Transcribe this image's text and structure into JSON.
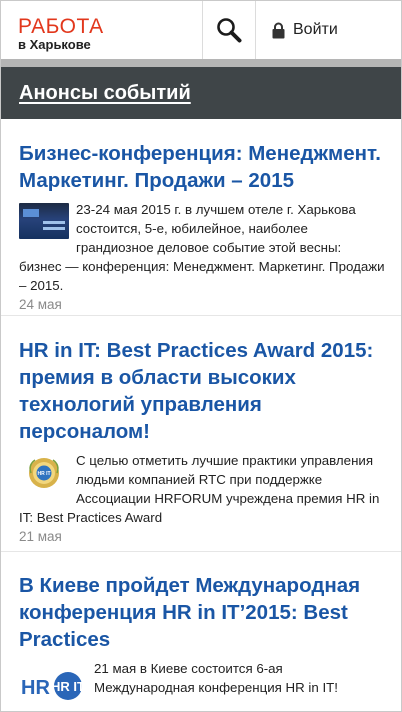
{
  "header": {
    "logo_top": "РАБОТА",
    "logo_bottom": "в Харькове",
    "login_label": "Войти"
  },
  "section": {
    "title": "Анонсы событий"
  },
  "articles": [
    {
      "title": "Бизнес-конференция: Менеджмент. Маркетинг. Продажи – 2015",
      "text": "23-24 мая 2015 г. в лучшем отеле г. Харькова состоится, 5-е, юбилейное, наиболее грандиозное деловое событие этой весны: бизнес — конференция: Менеджмент. Маркетинг. Продажи – 2015.",
      "date": "24 мая"
    },
    {
      "title": "HR in IT: Best Practices Award 2015: премия в области высоких технологий управления персоналом!",
      "text": "С целью отметить лучшие практики управления людьми компанией RTC при поддержке Ассоциации HRFORUM учреждена премия HR in IT: Best Practices Award",
      "date": "21 мая"
    },
    {
      "title": "В Киеве пройдет Международная конференция HR in IT’2015: Best Practices",
      "text": "21 мая в Киеве состоится 6-ая Международная конференция HR in IT!",
      "thumb_text": "HR IT"
    }
  ]
}
